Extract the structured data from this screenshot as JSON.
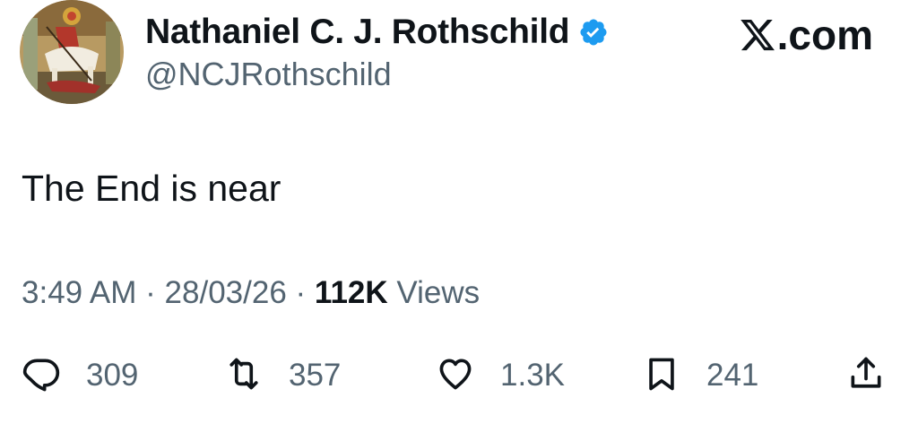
{
  "tweet": {
    "author": {
      "display_name": "Nathaniel C. J. Rothschild",
      "handle": "@NCJRothschild",
      "verified": true
    },
    "site_logo": ".com",
    "text": "The End is near",
    "time": "3:49 AM",
    "date": "28/03/26",
    "views_count": "112K",
    "views_label": "Views",
    "separator": "·",
    "actions": {
      "replies": "309",
      "reposts": "357",
      "likes": "1.3K",
      "bookmarks": "241"
    }
  },
  "colors": {
    "text_primary": "#0f1419",
    "text_secondary": "#536471",
    "verified_blue": "#1d9bf0"
  },
  "icons": [
    "verified-badge-icon",
    "x-logo-icon",
    "reply-icon",
    "repost-icon",
    "like-icon",
    "bookmark-icon",
    "share-icon"
  ]
}
